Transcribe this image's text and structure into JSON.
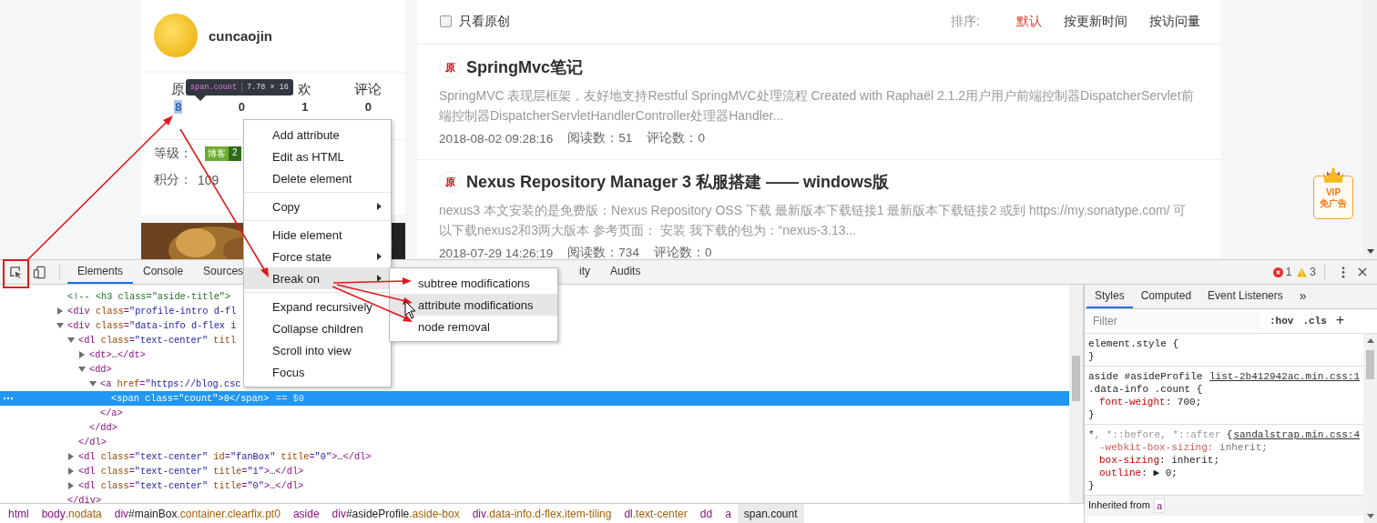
{
  "page": {
    "profile": {
      "name": "cuncaojin"
    },
    "tooltip": {
      "selector": "span.count",
      "size": "7.78 × 16"
    },
    "stats": [
      {
        "label": "原",
        "value": "8",
        "highlighted": true
      },
      {
        "value": "0",
        "highlighted": false
      },
      {
        "label": "欢",
        "value": "1",
        "highlighted": false
      },
      {
        "label": "评论",
        "value": "0",
        "highlighted": false
      }
    ],
    "level": {
      "label": "等级：",
      "badge_text": "博客",
      "badge_level": "2"
    },
    "points": {
      "label": "积分：",
      "value": "109"
    },
    "filter": {
      "label": "只看原创",
      "checked": false
    },
    "sort": {
      "label": "排序:",
      "options": [
        {
          "label": "默认",
          "selected": true
        },
        {
          "label": "按更新时间",
          "selected": false
        },
        {
          "label": "按访问量",
          "selected": false
        }
      ]
    },
    "articles": [
      {
        "badge": "原",
        "title": "SpringMvc笔记",
        "summary": "SpringMVC 表现层框架，友好地支持Restful SpringMVC处理流程 Created with Raphaël 2.1.2用户用户前端控制器DispatcherServlet前端控制器DispatcherServletHandlerController处理器Handler...",
        "date": "2018-08-02 09:28:16",
        "reads": "阅读数：51",
        "comments": "评论数：0"
      },
      {
        "badge": "原",
        "title": "Nexus Repository Manager 3 私服搭建 —— windows版",
        "summary": "nexus3 本文安装的是免费版：Nexus Repository OSS 下载 最新版本下载链接1 最新版本下载链接2 或到 https://my.sonatype.com/ 可以下载nexus2和3两大版本 参考页面： 安装 我下载的包为：“nexus-3.13...",
        "date": "2018-07-29 14:26:19",
        "reads": "阅读数：734",
        "comments": "评论数：0"
      }
    ],
    "vip_badge": {
      "line1": "VIP",
      "line2": "免广告"
    }
  },
  "devtools": {
    "tabs": [
      {
        "label": "Elements",
        "selected": true
      },
      {
        "label": "Console",
        "selected": false
      },
      {
        "label": "Sources",
        "selected": false
      },
      {
        "label": "ity",
        "selected": false
      },
      {
        "label": "Audits",
        "selected": false
      }
    ],
    "errors": "1",
    "warnings": "3",
    "tree": [
      {
        "kind": "comment",
        "text": "<!-- <h3 class=\"aside-title\">",
        "selected": false
      },
      {
        "kind": "element",
        "text": "<div class=\"profile-intro d-fl",
        "expanded": false,
        "selected": false
      },
      {
        "kind": "element",
        "text": "<div class=\"data-info d-flex i",
        "expanded": true,
        "selected": false,
        "close": "</div>",
        "children": [
          {
            "kind": "element",
            "text": "<dl class=\"text-center\" titl",
            "expanded": true,
            "selected": false,
            "close": "</dl>",
            "children": [
              {
                "kind": "element",
                "text": "<dt>…</dt>",
                "expanded": false,
                "selected": false
              },
              {
                "kind": "element",
                "text": "<dd>",
                "expanded": true,
                "selected": false,
                "close": "</dd>",
                "children": [
                  {
                    "kind": "element",
                    "text": "<a href=\"https://blog.csc",
                    "expanded": true,
                    "selected": false,
                    "close": "</a>",
                    "children": [
                      {
                        "kind": "element",
                        "text": "<span class=\"count\">8</span>",
                        "suffix": "== $0",
                        "selected": true
                      }
                    ]
                  }
                ]
              }
            ]
          },
          {
            "kind": "element",
            "text": "<dl class=\"text-center\" id=\"fanBox\" title=\"0\">…</dl>",
            "expanded": false,
            "selected": false
          },
          {
            "kind": "element",
            "text": "<dl class=\"text-center\" title=\"1\">…</dl>",
            "expanded": false,
            "selected": false
          },
          {
            "kind": "element",
            "text": "<dl class=\"text-center\" title=\"0\">…</dl>",
            "expanded": false,
            "selected": false
          }
        ]
      }
    ],
    "breadcrumbs": [
      {
        "label": "html",
        "selected": false
      },
      {
        "label": "body.nodata",
        "selected": false
      },
      {
        "label": "div#mainBox.container.clearfix.pt0",
        "selected": false
      },
      {
        "label": "aside",
        "selected": false
      },
      {
        "label": "div#asideProfile.aside-box",
        "selected": false
      },
      {
        "label": "div.data-info.d-flex.item-tiling",
        "selected": false
      },
      {
        "label": "dl.text-center",
        "selected": false
      },
      {
        "label": "dd",
        "selected": false
      },
      {
        "label": "a",
        "selected": false
      },
      {
        "label": "span.count",
        "selected": true
      }
    ],
    "side_tabs": [
      {
        "label": "Styles",
        "selected": true
      },
      {
        "label": "Computed",
        "selected": false
      },
      {
        "label": "Event Listeners",
        "selected": false
      }
    ],
    "more_tabs": "»",
    "filter": {
      "placeholder": "Filter",
      "hov": ":hov",
      "cls": ".cls",
      "add": "+"
    },
    "rules": [
      {
        "selector": [
          {
            "text": "element.style",
            "matched": true
          }
        ],
        "open": "{",
        "close": "}"
      },
      {
        "selector": [
          {
            "text": "aside #asideProfile .data-info .count",
            "matched": true
          }
        ],
        "source": "list-2b412942ac.min.css:1",
        "open": "{",
        "close": "}",
        "props": [
          {
            "text": "font-weight: 700;",
            "overridden": false
          }
        ]
      },
      {
        "selector": [
          {
            "text": "*",
            "matched": true
          },
          {
            "text": ", *::before, *::after",
            "matched": false
          }
        ],
        "source": "sandalstrap.min.css:4",
        "open": "{",
        "close": "}",
        "props": [
          {
            "text": "-webkit-box-sizing: inherit;",
            "overridden": true
          },
          {
            "text": "box-sizing: inherit;",
            "overridden": false
          },
          {
            "text": "outline: ▶ 0;",
            "overridden": false
          }
        ]
      }
    ],
    "inherited": {
      "label": "Inherited from",
      "element": "a"
    },
    "context_menu": {
      "groups": [
        [
          {
            "label": "Add attribute",
            "submenu": false,
            "highlighted": false
          },
          {
            "label": "Edit as HTML",
            "submenu": false,
            "highlighted": false
          },
          {
            "label": "Delete element",
            "submenu": false,
            "highlighted": false
          }
        ],
        [
          {
            "label": "Copy",
            "submenu": true,
            "highlighted": false
          }
        ],
        [
          {
            "label": "Hide element",
            "submenu": false,
            "highlighted": false
          },
          {
            "label": "Force state",
            "submenu": true,
            "highlighted": false
          },
          {
            "label": "Break on",
            "submenu": true,
            "highlighted": true
          }
        ],
        [
          {
            "label": "Expand recursively",
            "submenu": false,
            "highlighted": false
          },
          {
            "label": "Collapse children",
            "submenu": false,
            "highlighted": false
          },
          {
            "label": "Scroll into view",
            "submenu": false,
            "highlighted": false
          },
          {
            "label": "Focus",
            "submenu": false,
            "highlighted": false
          }
        ]
      ],
      "submenu": [
        {
          "label": "subtree modifications",
          "highlighted": false
        },
        {
          "label": "attribute modifications",
          "highlighted": true
        },
        {
          "label": "node removal",
          "highlighted": false
        }
      ]
    }
  }
}
